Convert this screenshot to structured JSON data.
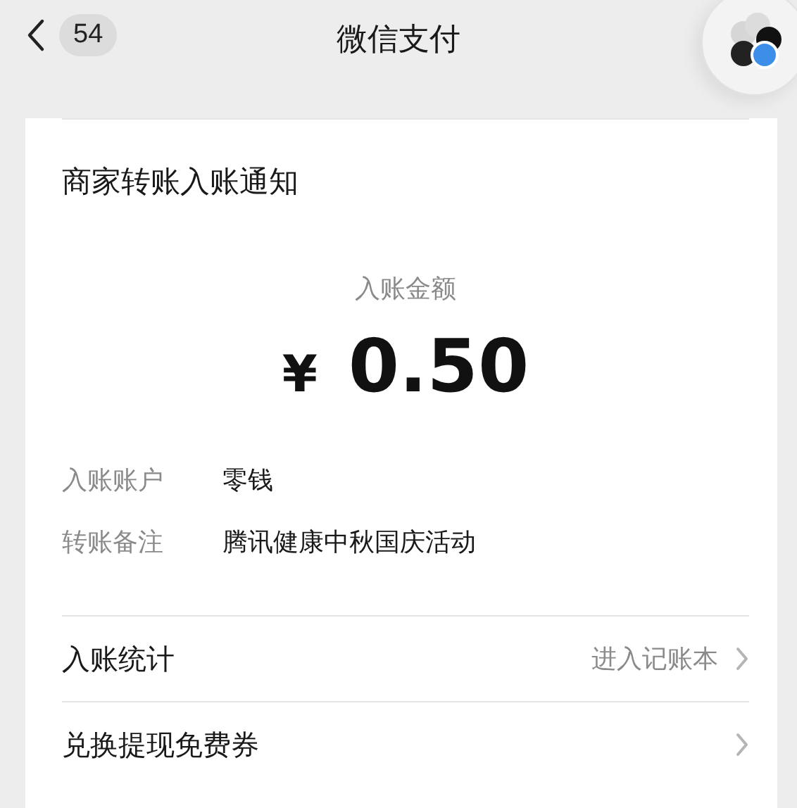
{
  "nav_bar": {
    "unread_count": "54",
    "title": "微信支付"
  },
  "card": {
    "title": "商家转账入账通知",
    "amount_label": "入账金额",
    "currency": "¥",
    "amount": "0.50",
    "details": [
      {
        "label": "入账账户",
        "value": "零钱"
      },
      {
        "label": "转账备注",
        "value": "腾讯健康中秋国庆活动"
      }
    ],
    "links": [
      {
        "label": "入账统计",
        "hint": "进入记账本"
      },
      {
        "label": "兑换提现免费券"
      }
    ]
  }
}
